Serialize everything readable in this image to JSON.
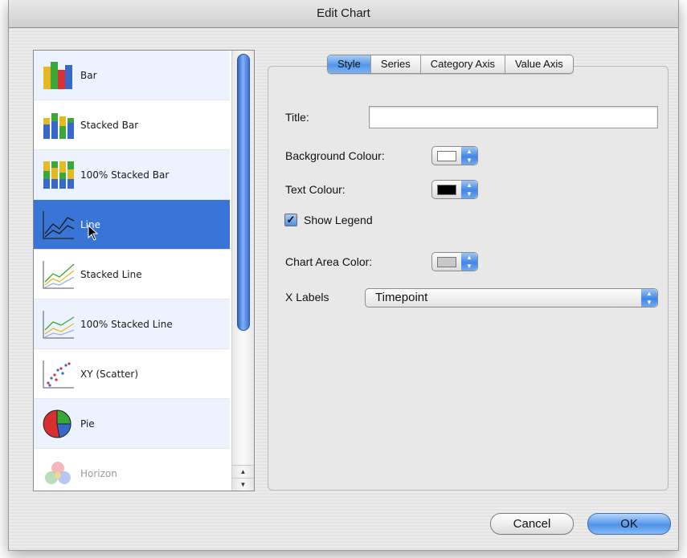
{
  "window": {
    "title": "Edit Chart"
  },
  "chart_types": [
    {
      "label": "Bar",
      "icon": "bar-chart-icon"
    },
    {
      "label": "Stacked Bar",
      "icon": "stacked-bar-chart-icon"
    },
    {
      "label": "100% Stacked Bar",
      "icon": "percent-stacked-bar-chart-icon"
    },
    {
      "label": "Line",
      "icon": "line-chart-icon",
      "selected": true
    },
    {
      "label": "Stacked Line",
      "icon": "stacked-line-chart-icon"
    },
    {
      "label": "100% Stacked Line",
      "icon": "percent-stacked-line-chart-icon"
    },
    {
      "label": "XY (Scatter)",
      "icon": "scatter-chart-icon"
    },
    {
      "label": "Pie",
      "icon": "pie-chart-icon"
    },
    {
      "label": "Horizon",
      "icon": "horizon-chart-icon",
      "disabled": true
    }
  ],
  "tabs": [
    "Style",
    "Series",
    "Category Axis",
    "Value Axis"
  ],
  "active_tab": "Style",
  "style": {
    "title_label": "Title:",
    "title_value": "",
    "background_label": "Background Colour:",
    "background_color": "#ffffff",
    "text_label": "Text Colour:",
    "text_color": "#000000",
    "legend_label": "Show Legend",
    "legend_checked": true,
    "chart_area_label": "Chart Area Color:",
    "chart_area_color": "#c8c8c8",
    "xlabels_label": "X Labels",
    "xlabels_value": "Timepoint"
  },
  "buttons": {
    "cancel": "Cancel",
    "ok": "OK"
  },
  "colors": {
    "selection": "#3875d7",
    "accent": "#4f93ea"
  }
}
